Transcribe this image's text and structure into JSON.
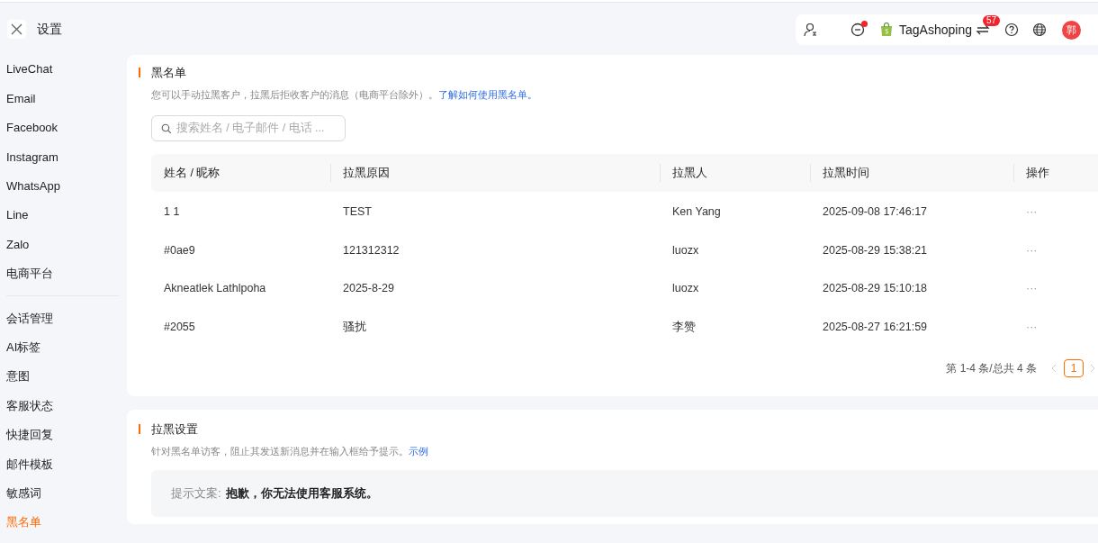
{
  "header": {
    "title": "设置",
    "store_name": "TagAshoping",
    "notification_count": "57",
    "avatar_text": "郭",
    "status_dot": true
  },
  "sidebar": {
    "groups": [
      {
        "items": [
          {
            "label": "LiveChat",
            "selected": false
          },
          {
            "label": "Email",
            "selected": false
          },
          {
            "label": "Facebook",
            "selected": false
          },
          {
            "label": "Instagram",
            "selected": false
          },
          {
            "label": "WhatsApp",
            "selected": false
          },
          {
            "label": "Line",
            "selected": false
          },
          {
            "label": "Zalo",
            "selected": false
          },
          {
            "label": "电商平台",
            "selected": false
          }
        ]
      },
      {
        "items": [
          {
            "label": "会话管理",
            "selected": false
          },
          {
            "label": "AI标签",
            "selected": false
          },
          {
            "label": "意图",
            "selected": false
          },
          {
            "label": "客服状态",
            "selected": false
          },
          {
            "label": "快捷回复",
            "selected": false
          },
          {
            "label": "邮件模板",
            "selected": false
          },
          {
            "label": "敏感词",
            "selected": false
          },
          {
            "label": "黑名单",
            "selected": true
          }
        ]
      }
    ]
  },
  "blacklist": {
    "title": "黑名单",
    "description": "您可以手动拉黑客户，拉黑后拒收客户的消息（电商平台除外）。",
    "link": "了解如何使用黑名单。",
    "search": {
      "placeholder": "搜索姓名 / 电子邮件 / 电话 ..."
    },
    "table": {
      "columns": [
        "姓名 / 昵称",
        "拉黑原因",
        "拉黑人",
        "拉黑时间",
        "操作"
      ],
      "rows": [
        {
          "cells": [
            "1 1",
            "TEST",
            "Ken Yang",
            "2025-09-08 17:46:17",
            "···"
          ]
        },
        {
          "cells": [
            "#0ae9",
            "121312312",
            "luozx",
            "2025-08-29 15:38:21",
            "···"
          ]
        },
        {
          "cells": [
            "Akneatlek Lathlpoha",
            "2025-8-29",
            "luozx",
            "2025-08-29 15:10:18",
            "···"
          ]
        },
        {
          "cells": [
            "#2055",
            "骚扰",
            "李赞",
            "2025-08-27 16:21:59",
            "···"
          ]
        }
      ]
    },
    "pagination": {
      "summary": "第 1-4 条/总共 4 条",
      "pages": [
        {
          "label": "1",
          "selected": true
        }
      ]
    }
  },
  "block_settings": {
    "title": "拉黑设置",
    "description": "针对黑名单访客，阻止其发送新消息并在输入框给予提示。",
    "link": "示例",
    "hint_label": "提示文案:",
    "hint_text": "抱歉，你无法使用客服系统。"
  }
}
